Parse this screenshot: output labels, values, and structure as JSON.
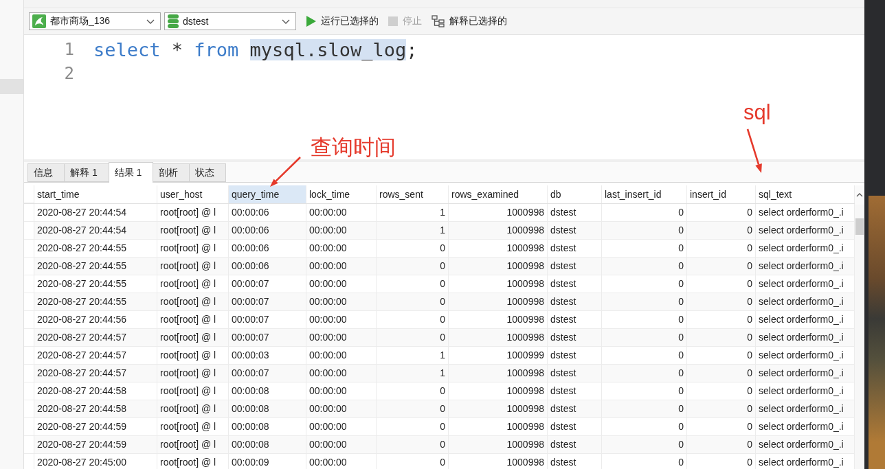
{
  "toolbar": {
    "connection": {
      "value": "都市商场_136"
    },
    "database": {
      "value": "dstest"
    },
    "actions": [
      {
        "kind": "run",
        "label": "运行已选择的",
        "disabled": false
      },
      {
        "kind": "stop",
        "label": "停止",
        "disabled": true
      },
      {
        "kind": "explain",
        "label": "解释已选择的",
        "disabled": false
      }
    ]
  },
  "editor": {
    "line_numbers": [
      "1",
      "2"
    ],
    "lines": [
      {
        "tokens": [
          {
            "text": "select",
            "kind": "keyword"
          },
          {
            "text": " * ",
            "kind": "plain"
          },
          {
            "text": "from ",
            "kind": "keyword"
          },
          {
            "text": "mysql.slow_log",
            "kind": "highlighted"
          },
          {
            "text": ";",
            "kind": "plain"
          }
        ]
      }
    ]
  },
  "result_tabs": [
    {
      "label": "信息",
      "selected": false
    },
    {
      "label": "解释 1",
      "selected": false
    },
    {
      "label": "结果 1",
      "selected": true
    },
    {
      "label": "剖析",
      "selected": false
    },
    {
      "label": "状态",
      "selected": false
    }
  ],
  "table": {
    "columns": [
      {
        "label": "start_time",
        "kind": "text",
        "selected": false
      },
      {
        "label": "user_host",
        "kind": "text",
        "selected": false
      },
      {
        "label": "query_time",
        "kind": "text",
        "selected": true
      },
      {
        "label": "lock_time",
        "kind": "text",
        "selected": false
      },
      {
        "label": "rows_sent",
        "kind": "number",
        "selected": false
      },
      {
        "label": "rows_examined",
        "kind": "number",
        "selected": false
      },
      {
        "label": "db",
        "kind": "text",
        "selected": false
      },
      {
        "label": "last_insert_id",
        "kind": "number",
        "selected": false
      },
      {
        "label": "insert_id",
        "kind": "number",
        "selected": false
      },
      {
        "label": "sql_text",
        "kind": "text",
        "selected": false
      }
    ],
    "rows": [
      [
        "2020-08-27 20:44:54",
        "root[root] @ l",
        "00:00:06",
        "00:00:00",
        "1",
        "1000998",
        "dstest",
        "0",
        "0",
        "select orderform0_.i"
      ],
      [
        "2020-08-27 20:44:54",
        "root[root] @ l",
        "00:00:06",
        "00:00:00",
        "1",
        "1000998",
        "dstest",
        "0",
        "0",
        "select orderform0_.i"
      ],
      [
        "2020-08-27 20:44:55",
        "root[root] @ l",
        "00:00:06",
        "00:00:00",
        "0",
        "1000998",
        "dstest",
        "0",
        "0",
        "select orderform0_.i"
      ],
      [
        "2020-08-27 20:44:55",
        "root[root] @ l",
        "00:00:06",
        "00:00:00",
        "0",
        "1000998",
        "dstest",
        "0",
        "0",
        "select orderform0_.i"
      ],
      [
        "2020-08-27 20:44:55",
        "root[root] @ l",
        "00:00:07",
        "00:00:00",
        "0",
        "1000998",
        "dstest",
        "0",
        "0",
        "select orderform0_.i"
      ],
      [
        "2020-08-27 20:44:55",
        "root[root] @ l",
        "00:00:07",
        "00:00:00",
        "0",
        "1000998",
        "dstest",
        "0",
        "0",
        "select orderform0_.i"
      ],
      [
        "2020-08-27 20:44:56",
        "root[root] @ l",
        "00:00:07",
        "00:00:00",
        "0",
        "1000998",
        "dstest",
        "0",
        "0",
        "select orderform0_.i"
      ],
      [
        "2020-08-27 20:44:57",
        "root[root] @ l",
        "00:00:07",
        "00:00:00",
        "0",
        "1000998",
        "dstest",
        "0",
        "0",
        "select orderform0_.i"
      ],
      [
        "2020-08-27 20:44:57",
        "root[root] @ l",
        "00:00:03",
        "00:00:00",
        "1",
        "1000999",
        "dstest",
        "0",
        "0",
        "select orderform0_.i"
      ],
      [
        "2020-08-27 20:44:57",
        "root[root] @ l",
        "00:00:07",
        "00:00:00",
        "1",
        "1000998",
        "dstest",
        "0",
        "0",
        "select orderform0_.i"
      ],
      [
        "2020-08-27 20:44:58",
        "root[root] @ l",
        "00:00:08",
        "00:00:00",
        "0",
        "1000998",
        "dstest",
        "0",
        "0",
        "select orderform0_.i"
      ],
      [
        "2020-08-27 20:44:58",
        "root[root] @ l",
        "00:00:08",
        "00:00:00",
        "0",
        "1000998",
        "dstest",
        "0",
        "0",
        "select orderform0_.i"
      ],
      [
        "2020-08-27 20:44:59",
        "root[root] @ l",
        "00:00:08",
        "00:00:00",
        "0",
        "1000998",
        "dstest",
        "0",
        "0",
        "select orderform0_.i"
      ],
      [
        "2020-08-27 20:44:59",
        "root[root] @ l",
        "00:00:08",
        "00:00:00",
        "0",
        "1000998",
        "dstest",
        "0",
        "0",
        "select orderform0_.i"
      ],
      [
        "2020-08-27 20:45:00",
        "root[root] @ l",
        "00:00:09",
        "00:00:00",
        "0",
        "1000998",
        "dstest",
        "0",
        "0",
        "select orderform0_.i"
      ]
    ]
  },
  "annotations": [
    {
      "text": "查询时间"
    },
    {
      "text": "sql"
    }
  ]
}
